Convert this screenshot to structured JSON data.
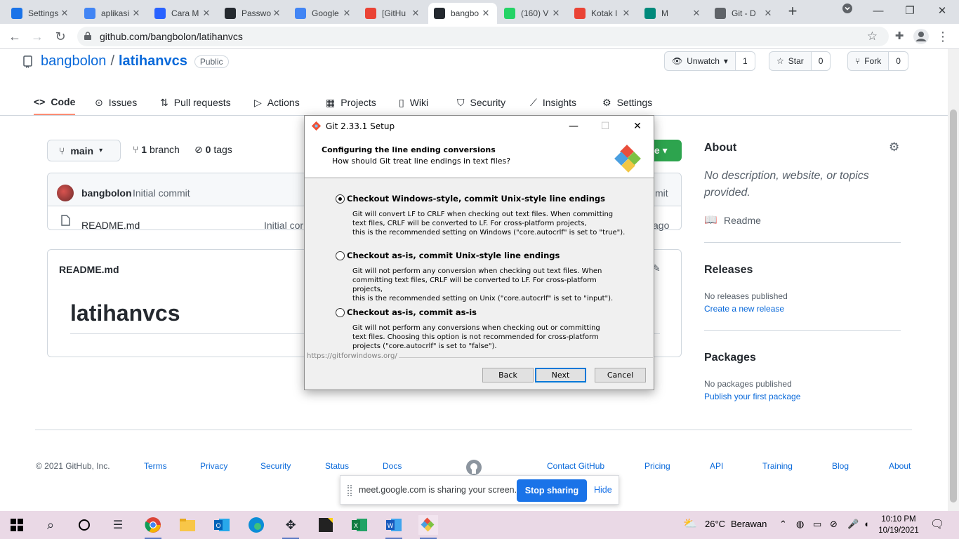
{
  "browser": {
    "tabs": [
      {
        "title": "Settings",
        "icon": "gear-icon",
        "color": "#1a73e8"
      },
      {
        "title": "aplikasi",
        "icon": "google-icon",
        "color": "#4285f4"
      },
      {
        "title": "Cara M",
        "icon": "chart-icon",
        "color": "#2962ff"
      },
      {
        "title": "Passwo",
        "icon": "github-icon",
        "color": "#24292f"
      },
      {
        "title": "Google",
        "icon": "translate-icon",
        "color": "#4285f4"
      },
      {
        "title": "[GitHu",
        "icon": "gmail-icon",
        "color": "#ea4335"
      },
      {
        "title": "bangbo",
        "icon": "github-icon",
        "color": "#24292f"
      },
      {
        "title": "(160) V",
        "icon": "whatsapp-icon",
        "color": "#25d366"
      },
      {
        "title": "Kotak I",
        "icon": "gmail-icon",
        "color": "#ea4335"
      },
      {
        "title": "M",
        "icon": "meet-icon",
        "color": "#00897b"
      },
      {
        "title": "Git - D",
        "icon": "globe-icon",
        "color": "#5f6368"
      }
    ],
    "active_tab": 6,
    "url": "github.com/bangbolon/latihanvcs"
  },
  "repo": {
    "owner": "bangbolon",
    "separator": "/",
    "name": "latihanvcs",
    "visibility": "Public",
    "unwatch_label": "Unwatch",
    "unwatch_count": "1",
    "star_label": "Star",
    "star_count": "0",
    "fork_label": "Fork",
    "fork_count": "0"
  },
  "nav": [
    "Code",
    "Issues",
    "Pull requests",
    "Actions",
    "Projects",
    "Wiki",
    "Security",
    "Insights",
    "Settings"
  ],
  "code": {
    "branch": "main",
    "branch_count": "1",
    "branch_label": "branch",
    "tag_count": "0",
    "tag_label": "tags",
    "code_button": "le",
    "commit_author": "bangbolon",
    "commit_message": "Initial commit",
    "commit_right": "mit",
    "file_name": "README.md",
    "file_commit": "Initial cor",
    "file_age": "ago",
    "readme_title": "README.md",
    "readme_heading": "latihanvcs"
  },
  "about": {
    "title": "About",
    "description": "No description, website, or topics provided.",
    "readme_label": "Readme",
    "releases_title": "Releases",
    "no_releases": "No releases published",
    "create_release": "Create a new release",
    "packages_title": "Packages",
    "no_packages": "No packages published",
    "publish_package": "Publish your first package"
  },
  "footer": {
    "copyright": "© 2021 GitHub, Inc.",
    "links_left": [
      "Terms",
      "Privacy",
      "Security",
      "Status",
      "Docs"
    ],
    "links_right": [
      "Contact GitHub",
      "Pricing",
      "API",
      "Training",
      "Blog",
      "About"
    ]
  },
  "dialog": {
    "title": "Git 2.33.1 Setup",
    "heading": "Configuring the line ending conversions",
    "subheading": "How should Git treat line endings in text files?",
    "options": [
      {
        "label": "Checkout Windows-style, commit Unix-style line endings",
        "selected": true,
        "desc": "Git will convert LF to CRLF when checking out text files. When committing\ntext files, CRLF will be converted to LF. For cross-platform projects,\nthis is the recommended setting on Windows (\"core.autocrlf\" is set to \"true\")."
      },
      {
        "label": "Checkout as-is, commit Unix-style line endings",
        "selected": false,
        "desc": "Git will not perform any conversion when checking out text files. When\ncommitting text files, CRLF will be converted to LF. For cross-platform projects,\nthis is the recommended setting on Unix (\"core.autocrlf\" is set to \"input\")."
      },
      {
        "label": "Checkout as-is, commit as-is",
        "selected": false,
        "desc": "Git will not perform any conversions when checking out or committing\ntext files. Choosing this option is not recommended for cross-platform\nprojects (\"core.autocrlf\" is set to \"false\")."
      }
    ],
    "url": "https://gitforwindows.org/",
    "back": "Back",
    "next": "Next",
    "cancel": "Cancel"
  },
  "meet": {
    "message": "meet.google.com is sharing your screen.",
    "stop": "Stop sharing",
    "hide": "Hide"
  },
  "taskbar": {
    "weather_temp": "26°C",
    "weather_desc": "Berawan",
    "time": "10:10 PM",
    "date": "10/19/2021"
  }
}
